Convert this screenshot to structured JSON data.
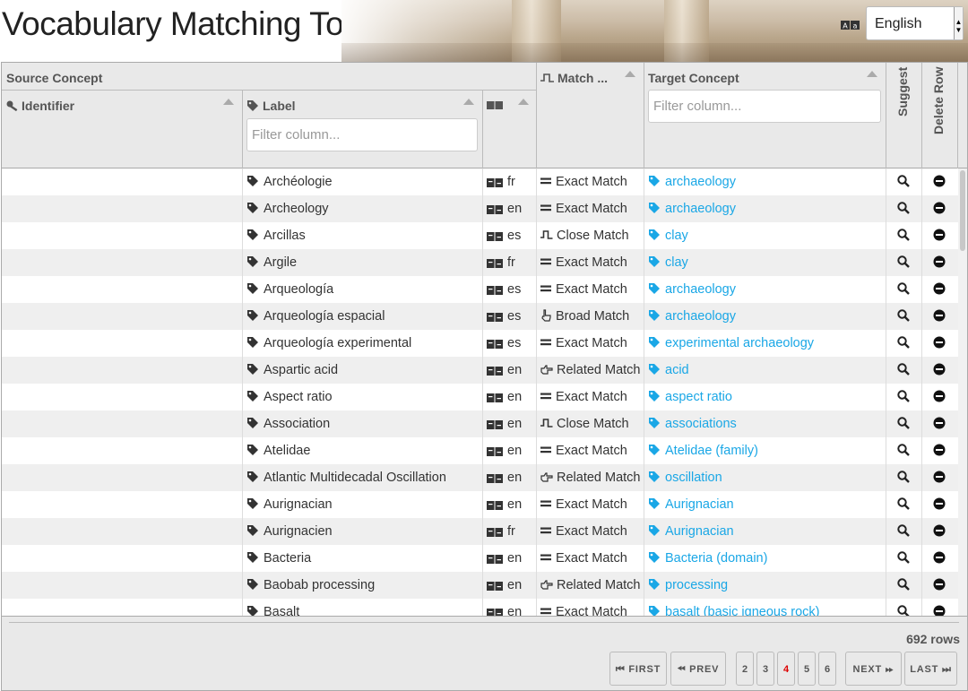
{
  "app": {
    "title": "Vocabulary Matching Tool"
  },
  "language_select": {
    "value": "English"
  },
  "icons": {
    "lang": "language-icon",
    "key": "key-icon",
    "tag": "tag-icon",
    "exact": "equals-icon",
    "close": "close-match-icon",
    "broad": "pointer-icon",
    "related": "hand-right-icon",
    "search": "search-icon",
    "remove": "minus-circle-icon"
  },
  "colors": {
    "link": "#1aa7e6",
    "active_page": "#dd0000"
  },
  "table": {
    "source_group": "Source Concept",
    "col_identifier": "Identifier",
    "col_label": "Label",
    "col_match": "Match ...",
    "col_target": "Target Concept",
    "col_suggest": "Suggest",
    "col_delete": "Delete Row",
    "filter_label_placeholder": "Filter column...",
    "filter_target_placeholder": "Filter column...",
    "rows": [
      {
        "label": "Archéologie",
        "lang": "fr",
        "match": "Exact Match",
        "match_icon": "exact",
        "target": "archaeology"
      },
      {
        "label": "Archeology",
        "lang": "en",
        "match": "Exact Match",
        "match_icon": "exact",
        "target": "archaeology"
      },
      {
        "label": "Arcillas",
        "lang": "es",
        "match": "Close Match",
        "match_icon": "close",
        "target": "clay"
      },
      {
        "label": "Argile",
        "lang": "fr",
        "match": "Exact Match",
        "match_icon": "exact",
        "target": "clay"
      },
      {
        "label": "Arqueología",
        "lang": "es",
        "match": "Exact Match",
        "match_icon": "exact",
        "target": "archaeology"
      },
      {
        "label": "Arqueología espacial",
        "lang": "es",
        "match": "Broad Match",
        "match_icon": "broad",
        "target": "archaeology"
      },
      {
        "label": "Arqueología experimental",
        "lang": "es",
        "match": "Exact Match",
        "match_icon": "exact",
        "target": "experimental archaeology"
      },
      {
        "label": "Aspartic acid",
        "lang": "en",
        "match": "Related Match",
        "match_icon": "related",
        "target": "acid"
      },
      {
        "label": "Aspect ratio",
        "lang": "en",
        "match": "Exact Match",
        "match_icon": "exact",
        "target": "aspect ratio"
      },
      {
        "label": "Association",
        "lang": "en",
        "match": "Close Match",
        "match_icon": "close",
        "target": "associations"
      },
      {
        "label": "Atelidae",
        "lang": "en",
        "match": "Exact Match",
        "match_icon": "exact",
        "target": "Atelidae (family)"
      },
      {
        "label": "Atlantic Multidecadal Oscillation",
        "lang": "en",
        "match": "Related Match",
        "match_icon": "related",
        "target": "oscillation"
      },
      {
        "label": "Aurignacian",
        "lang": "en",
        "match": "Exact Match",
        "match_icon": "exact",
        "target": "Aurignacian"
      },
      {
        "label": "Aurignacien",
        "lang": "fr",
        "match": "Exact Match",
        "match_icon": "exact",
        "target": "Aurignacian"
      },
      {
        "label": "Bacteria",
        "lang": "en",
        "match": "Exact Match",
        "match_icon": "exact",
        "target": "Bacteria (domain)"
      },
      {
        "label": "Baobab processing",
        "lang": "en",
        "match": "Related Match",
        "match_icon": "related",
        "target": "processing"
      },
      {
        "label": "Basalt",
        "lang": "en",
        "match": "Exact Match",
        "match_icon": "exact",
        "target": "basalt (basic igneous rock)"
      }
    ]
  },
  "footer": {
    "row_count": "692 rows",
    "first": "FIRST",
    "prev": "PREV",
    "next": "NEXT",
    "last": "LAST",
    "pages": [
      "2",
      "3",
      "4",
      "5",
      "6"
    ],
    "current_page": "4"
  }
}
